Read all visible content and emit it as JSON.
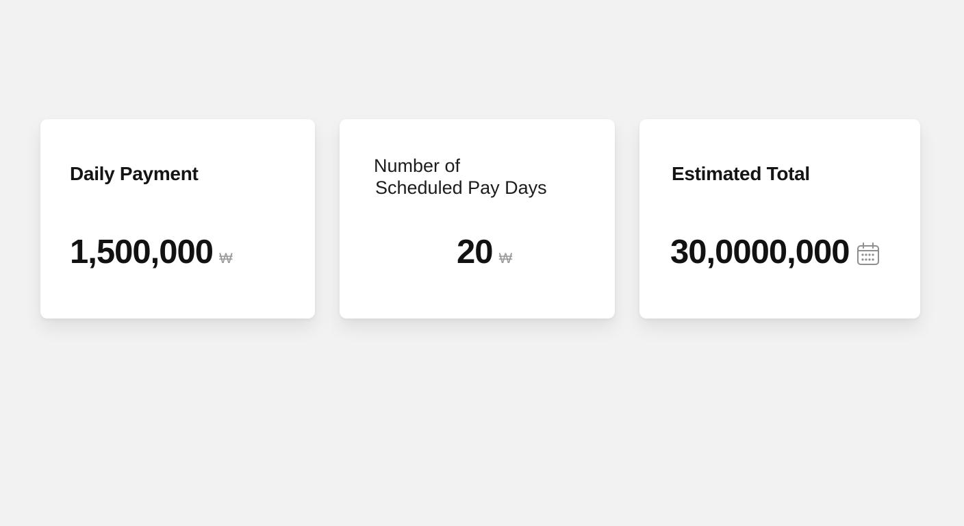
{
  "cards": [
    {
      "label": "Daily Payment",
      "value": "1,500,000",
      "unit": "₩"
    },
    {
      "label_line1": "Number of",
      "label_line2": "Scheduled Pay Days",
      "value": "20",
      "unit": "₩"
    },
    {
      "label": "Estimated Total",
      "value": "30,0000,000",
      "icon": "calendar-icon"
    }
  ],
  "colors": {
    "background": "#f2f2f2",
    "card": "#ffffff",
    "text": "#121212",
    "muted": "#9a9a9a"
  }
}
